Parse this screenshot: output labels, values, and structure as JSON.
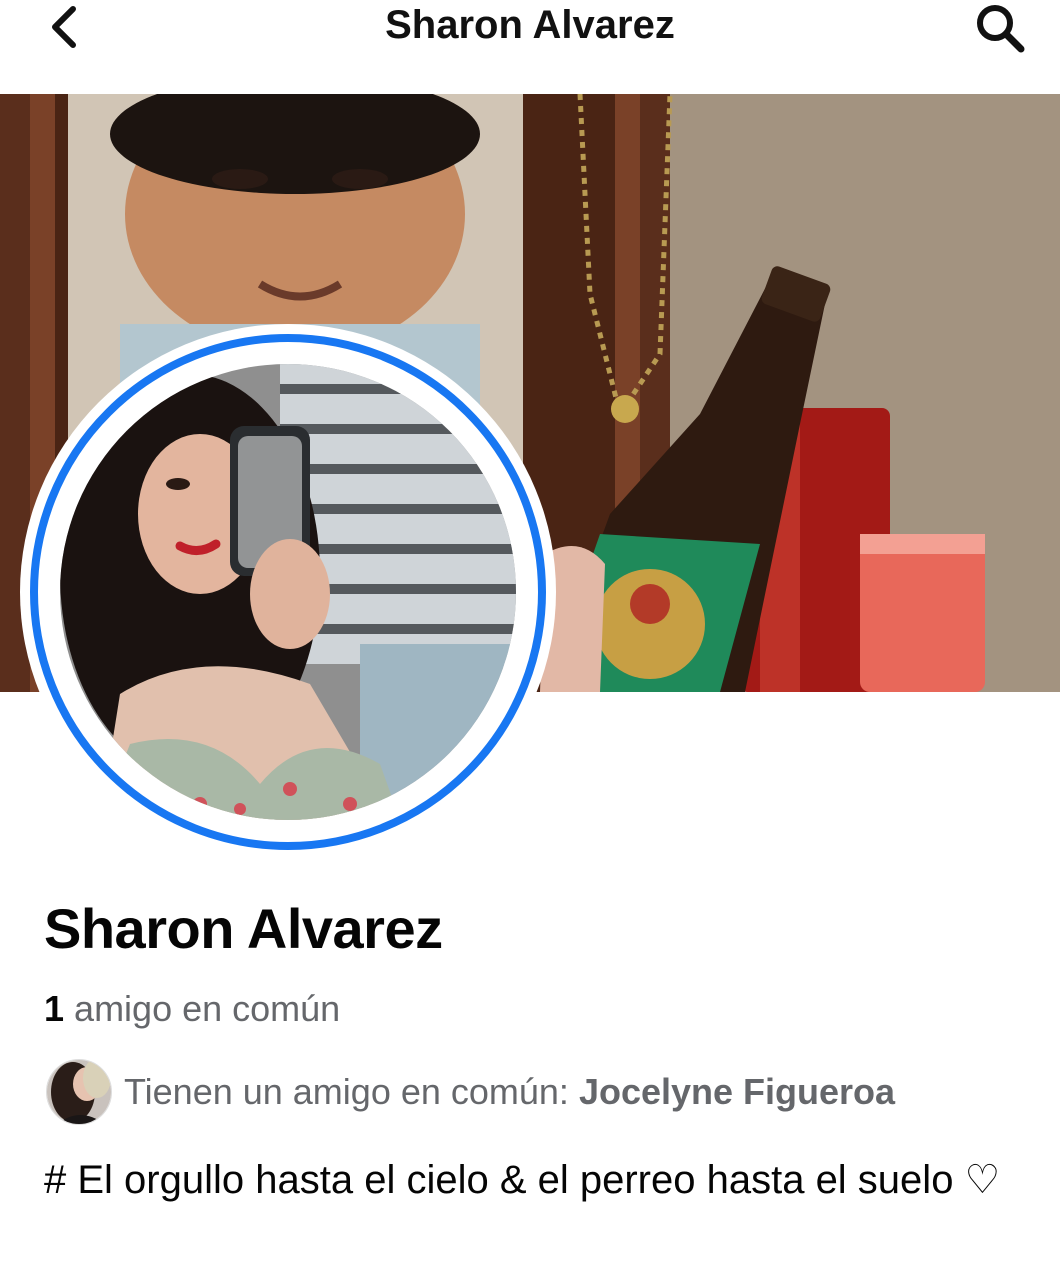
{
  "header": {
    "title": "Sharon Alvarez",
    "back_icon": "chevron-left-icon",
    "search_icon": "search-icon"
  },
  "profile": {
    "name": "Sharon Alvarez",
    "mutual_count": "1",
    "mutual_count_label": "amigo en común",
    "mutual_friends_prefix": "Tienen un amigo en común:",
    "mutual_friend_name": "Jocelyne Figueroa",
    "bio": "# El orgullo hasta el cielo & el perreo hasta el suelo ♡"
  },
  "colors": {
    "accent_ring": "#1877f2",
    "secondary_text": "#65676b",
    "primary_text": "#050505"
  }
}
